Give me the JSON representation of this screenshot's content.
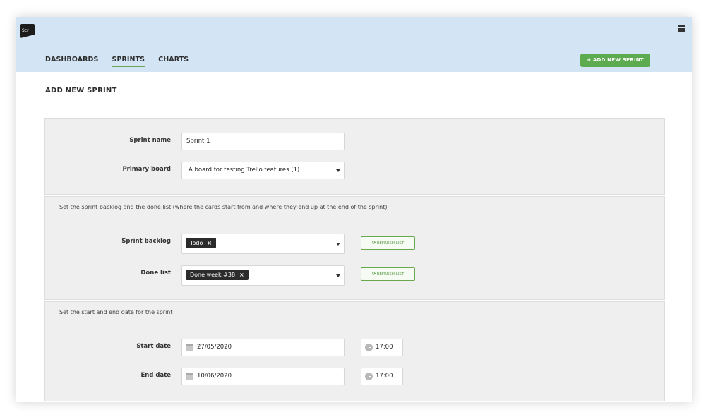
{
  "app": {
    "logo_text": "Scr"
  },
  "nav": {
    "items": [
      {
        "label": "DASHBOARDS",
        "active": false
      },
      {
        "label": "SPRINTS",
        "active": true
      },
      {
        "label": "CHARTS",
        "active": false
      }
    ],
    "add_button": "+ ADD NEW SPRINT",
    "menu_icon": "hamburger-icon"
  },
  "page": {
    "title": "ADD NEW SPRINT"
  },
  "basics": {
    "sprint_name_label": "Sprint name",
    "sprint_name_value": "Sprint 1",
    "primary_board_label": "Primary board",
    "primary_board_value": "A board for testing Trello features (1)"
  },
  "lists": {
    "description": "Set the sprint backlog and the done list (where the cards start from and where they end up at the end of the sprint)",
    "backlog_label": "Sprint backlog",
    "backlog_tag": "Todo",
    "done_label": "Done list",
    "done_tag": "Done week #38",
    "tag_remove": "×",
    "refresh_label": "REFRESH LIST"
  },
  "dates": {
    "description": "Set the start and end date for the sprint",
    "start_label": "Start date",
    "start_value": "27/05/2020",
    "start_time": "17:00",
    "end_label": "End date",
    "end_value": "10/06/2020",
    "end_time": "17:00"
  },
  "colors": {
    "header_bg": "#d3e4f4",
    "accent": "#5cab4f",
    "panel_bg": "#efefef"
  }
}
